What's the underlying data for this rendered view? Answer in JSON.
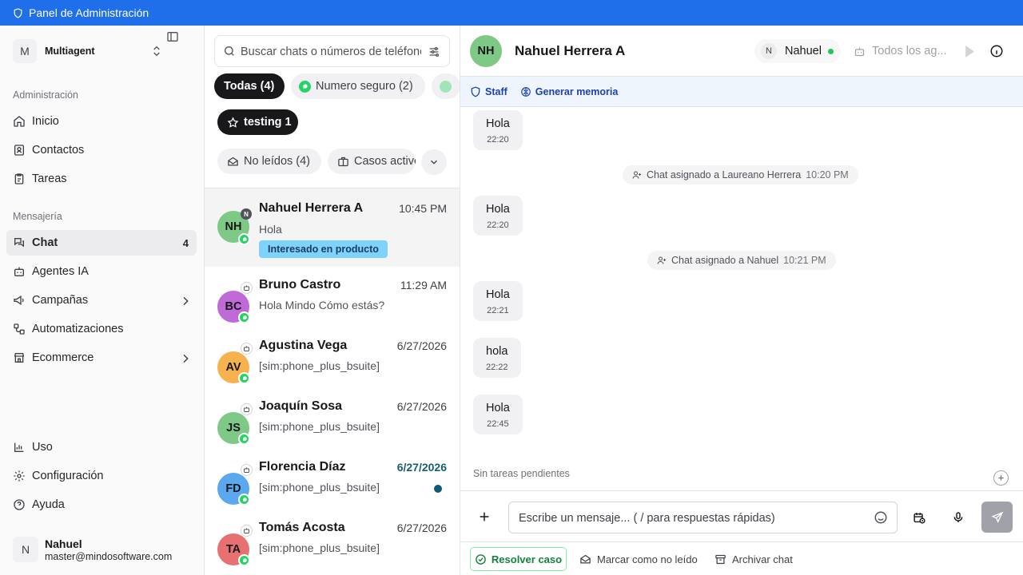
{
  "topbar": {
    "title": "Panel de Administración"
  },
  "workspace": {
    "initial": "M",
    "name": "Multiagent"
  },
  "sidebar": {
    "section_admin": "Administración",
    "section_msg": "Mensajería",
    "items": [
      {
        "label": "Inicio",
        "icon": "home-icon"
      },
      {
        "label": "Contactos",
        "icon": "contact-card-icon"
      },
      {
        "label": "Tareas",
        "icon": "clipboard-icon"
      },
      {
        "label": "Chat",
        "icon": "chat-icon",
        "count": "4",
        "active": true
      },
      {
        "label": "Agentes IA",
        "icon": "bot-icon"
      },
      {
        "label": "Campañas",
        "icon": "megaphone-icon"
      },
      {
        "label": "Automatizaciones",
        "icon": "workflow-icon"
      },
      {
        "label": "Ecommerce",
        "icon": "store-icon"
      },
      {
        "label": "Uso",
        "icon": "bar-chart-icon"
      },
      {
        "label": "Configuración",
        "icon": "gear-icon"
      },
      {
        "label": "Ayuda",
        "icon": "help-icon"
      }
    ]
  },
  "user": {
    "initial": "N",
    "name": "Nahuel",
    "email": "master@mindosoftware.com"
  },
  "chatlist": {
    "search_placeholder": "Buscar chats o números de teléfono",
    "filters": {
      "all": "Todas (4)",
      "secure": "Numero seguro (2)",
      "testing": "testing 1",
      "unread": "No leídos (4)",
      "active_cases": "Casos activos"
    },
    "chats": [
      {
        "initials": "NH",
        "name": "Nahuel Herrera A",
        "time": "10:45 PM",
        "preview": "Hola",
        "tag": "Interesado en producto",
        "badge": "N",
        "color": "#7ec986"
      },
      {
        "initials": "BC",
        "name": "Bruno Castro",
        "time": "11:29 AM",
        "preview": "Hola Mindo Cómo estás?",
        "color": "#c06ad8"
      },
      {
        "initials": "AV",
        "name": "Agustina Vega",
        "time": "6/27/2026",
        "preview": "[sim:phone_plus_bsuite]",
        "color": "#f7b250"
      },
      {
        "initials": "JS",
        "name": "Joaquín Sosa",
        "time": "6/27/2026",
        "preview": "[sim:phone_plus_bsuite]",
        "color": "#7ec986"
      },
      {
        "initials": "FD",
        "name": "Florencia Díaz",
        "time": "6/27/2026",
        "preview": "[sim:phone_plus_bsuite]",
        "color": "#5ba8ee",
        "unread": true
      },
      {
        "initials": "TA",
        "name": "Tomás Acosta",
        "time": "6/27/2026",
        "preview": "[sim:phone_plus_bsuite]",
        "color": "#e77171"
      }
    ]
  },
  "conversation": {
    "initials": "NH",
    "name": "Nahuel Herrera A",
    "agent_initial": "N",
    "agent_name": "Nahuel",
    "all_agents": "Todos los ag...",
    "staff_label": "Staff",
    "memory_label": "Generar memoria",
    "messages": [
      {
        "text": "Hola",
        "time": "22:20"
      },
      {
        "text": "Hola",
        "time": "22:20"
      },
      {
        "text": "Hola",
        "time": "22:21"
      },
      {
        "text": "hola",
        "time": "22:22"
      },
      {
        "text": "Hola",
        "time": "22:45"
      }
    ],
    "system": [
      {
        "text": "Chat asignado a Laureano Herrera",
        "time": "10:20 PM"
      },
      {
        "text": "Chat asignado a Nahuel",
        "time": "10:21 PM"
      }
    ],
    "tasks_text": "Sin tareas pendientes",
    "composer_placeholder": "Escribe un mensaje... ( / para respuestas rápidas)",
    "footer": {
      "resolve": "Resolver caso",
      "mark_unread": "Marcar como no leído",
      "archive": "Archivar chat"
    }
  },
  "colors": {
    "accent": "#1f6feb",
    "whatsapp": "#25d366",
    "online": "#22c55e",
    "tag": "#7dd3fc"
  }
}
